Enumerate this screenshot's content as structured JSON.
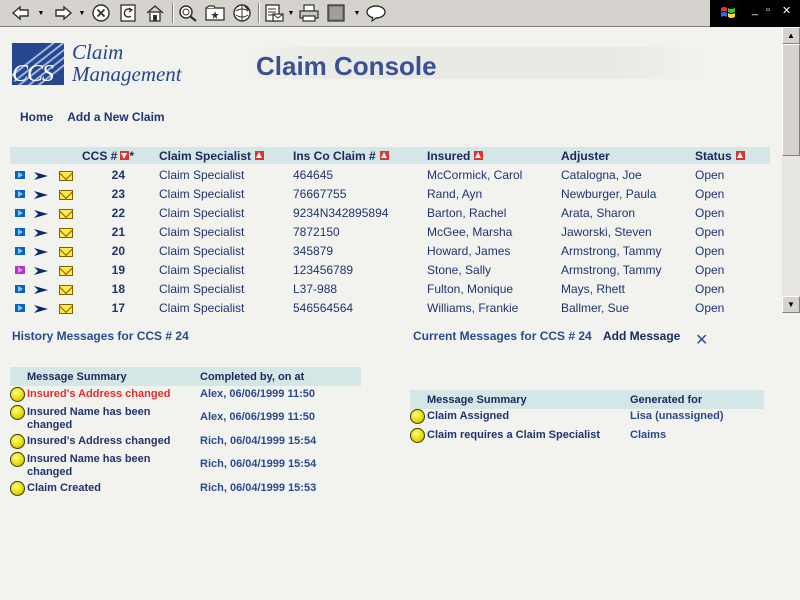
{
  "toolbar": {
    "icons": [
      "back-icon",
      "forward-icon",
      "stop-icon",
      "refresh-icon",
      "home-icon",
      "search-icon",
      "favorites-icon",
      "history-icon",
      "mail-icon",
      "print-icon",
      "edit-icon",
      "discuss-icon"
    ]
  },
  "header": {
    "logo_ccs": "CCS",
    "logo_line1": "Claim",
    "logo_line2": "Management",
    "title": "Claim Console"
  },
  "nav": {
    "home": "Home",
    "add_claim": "Add a New Claim"
  },
  "claims_table": {
    "columns": {
      "ccs": "CCS #",
      "star": "*",
      "specialist": "Claim Specialist",
      "ins_claim": "Ins Co Claim #",
      "insured": "Insured",
      "adjuster": "Adjuster",
      "status": "Status"
    },
    "rows": [
      {
        "ccs": "24",
        "specialist": "Claim Specialist",
        "ins_claim": "464645",
        "insured": "McCormick, Carol",
        "adjuster": "Catalogna, Joe",
        "status": "Open"
      },
      {
        "ccs": "23",
        "specialist": "Claim Specialist",
        "ins_claim": "76667755",
        "insured": "Rand, Ayn",
        "adjuster": "Newburger, Paula",
        "status": "Open"
      },
      {
        "ccs": "22",
        "specialist": "Claim Specialist",
        "ins_claim": "9234N342895894",
        "insured": "Barton, Rachel",
        "adjuster": "Arata, Sharon",
        "status": "Open"
      },
      {
        "ccs": "21",
        "specialist": "Claim Specialist",
        "ins_claim": "7872150",
        "insured": "McGee, Marsha",
        "adjuster": "Jaworski, Steven",
        "status": "Open"
      },
      {
        "ccs": "20",
        "specialist": "Claim Specialist",
        "ins_claim": "345879",
        "insured": "Howard, James",
        "adjuster": "Armstrong, Tammy",
        "status": "Open"
      },
      {
        "ccs": "19",
        "specialist": "Claim Specialist",
        "ins_claim": "123456789",
        "insured": "Stone, Sally",
        "adjuster": "Armstrong, Tammy",
        "status": "Open"
      },
      {
        "ccs": "18",
        "specialist": "Claim Specialist",
        "ins_claim": "L37-988",
        "insured": "Fulton, Monique",
        "adjuster": "Mays, Rhett",
        "status": "Open"
      },
      {
        "ccs": "17",
        "specialist": "Claim Specialist",
        "ins_claim": "546564564",
        "insured": "Williams, Frankie",
        "adjuster": "Ballmer, Sue",
        "status": "Open"
      }
    ]
  },
  "history": {
    "title": "History Messages for CCS # 24",
    "col_summary": "Message Summary",
    "col_completed": "Completed by, on at",
    "items": [
      {
        "summary": "Insured's Address changed",
        "by": "Alex, 06/06/1999 11:50",
        "highlight": true
      },
      {
        "summary": "Insured Name has been changed",
        "by": "Alex, 06/06/1999 11:50",
        "highlight": false
      },
      {
        "summary": "Insured's Address changed",
        "by": "Rich, 06/04/1999 15:54",
        "highlight": false
      },
      {
        "summary": "Insured Name has been changed",
        "by": "Rich, 06/04/1999 15:54",
        "highlight": false
      },
      {
        "summary": "Claim Created",
        "by": "Rich, 06/04/1999 15:53",
        "highlight": false
      }
    ]
  },
  "current": {
    "title": "Current Messages for CCS # 24",
    "add_message": "Add Message",
    "close": "✕",
    "col_summary": "Message Summary",
    "col_generated": "Generated for",
    "items": [
      {
        "summary": "Claim Assigned",
        "for": "Lisa (unassigned)"
      },
      {
        "summary": "Claim requires a Claim Specialist",
        "for": "Claims"
      }
    ]
  },
  "colors": {
    "accent": "#3a5095",
    "header_band": "#d5e6e6",
    "highlight_red": "#e22b2b"
  }
}
